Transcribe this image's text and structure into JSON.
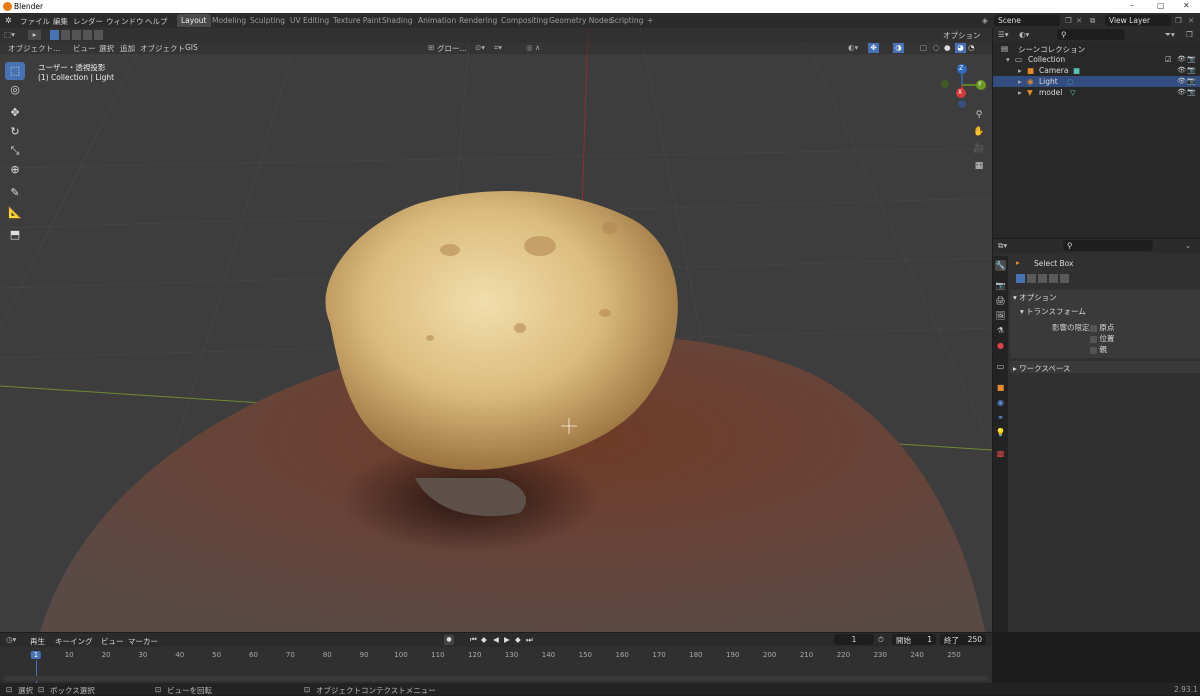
{
  "window": {
    "title": "Blender",
    "controls": [
      "–",
      "▢",
      "✕"
    ]
  },
  "menubar": {
    "items": [
      "ファイル",
      "編集",
      "レンダー",
      "ウィンドウ",
      "ヘルプ"
    ]
  },
  "workspaces": [
    "Layout",
    "Modeling",
    "Sculpting",
    "UV Editing",
    "Texture Paint",
    "Shading",
    "Animation",
    "Rendering",
    "Compositing",
    "Geometry Nodes",
    "Scripting"
  ],
  "active_workspace": "Layout",
  "add_workspace": "+",
  "scene": {
    "name": "Scene",
    "view_layer": "View Layer"
  },
  "viewport": {
    "header_items": [
      "オブジェクト...",
      "ビュー",
      "選択",
      "追加",
      "オブジェクト",
      "GIS"
    ],
    "transform_orientation": "グロー...",
    "options_label": "オプション",
    "info_line1": "ユーザー・透視投影",
    "info_line2": "(1) Collection | Light",
    "gizmo_axes": {
      "z": "Z",
      "y": "Y",
      "x": "X"
    }
  },
  "outliner": {
    "root": "シーンコレクション",
    "collection": "Collection",
    "items": [
      {
        "name": "Camera",
        "type": "camera",
        "selected": false
      },
      {
        "name": "Light",
        "type": "light",
        "selected": true
      },
      {
        "name": "model",
        "type": "mesh",
        "selected": false
      }
    ]
  },
  "properties": {
    "tool_name": "Select Box",
    "options_header": "オプション",
    "transform_header": "トランスフォーム",
    "affect_only_label": "影響の限定",
    "affect_options": [
      "原点",
      "位置",
      "親"
    ],
    "workspace_header": "ワークスペース"
  },
  "timeline": {
    "menus": [
      "再生",
      "キーイング",
      "ビュー",
      "マーカー"
    ],
    "current_frame": "1",
    "start_label": "開始",
    "start": "1",
    "end_label": "終了",
    "end": "250",
    "ticks": [
      "1",
      "10",
      "20",
      "30",
      "40",
      "50",
      "60",
      "70",
      "80",
      "90",
      "100",
      "110",
      "120",
      "130",
      "140",
      "150",
      "160",
      "170",
      "180",
      "190",
      "200",
      "210",
      "220",
      "230",
      "240",
      "250"
    ]
  },
  "statusbar": {
    "select": "選択",
    "box_select": "ボックス選択",
    "rotate_view": "ビューを回転",
    "context_menu": "オブジェクトコンテクストメニュー",
    "version": "2.93.1"
  },
  "colors": {
    "accent": "#4772b3",
    "selection_row": "#334d80",
    "header_bg": "#2b2b2b",
    "viewport_bg": "#3d3d3d"
  }
}
